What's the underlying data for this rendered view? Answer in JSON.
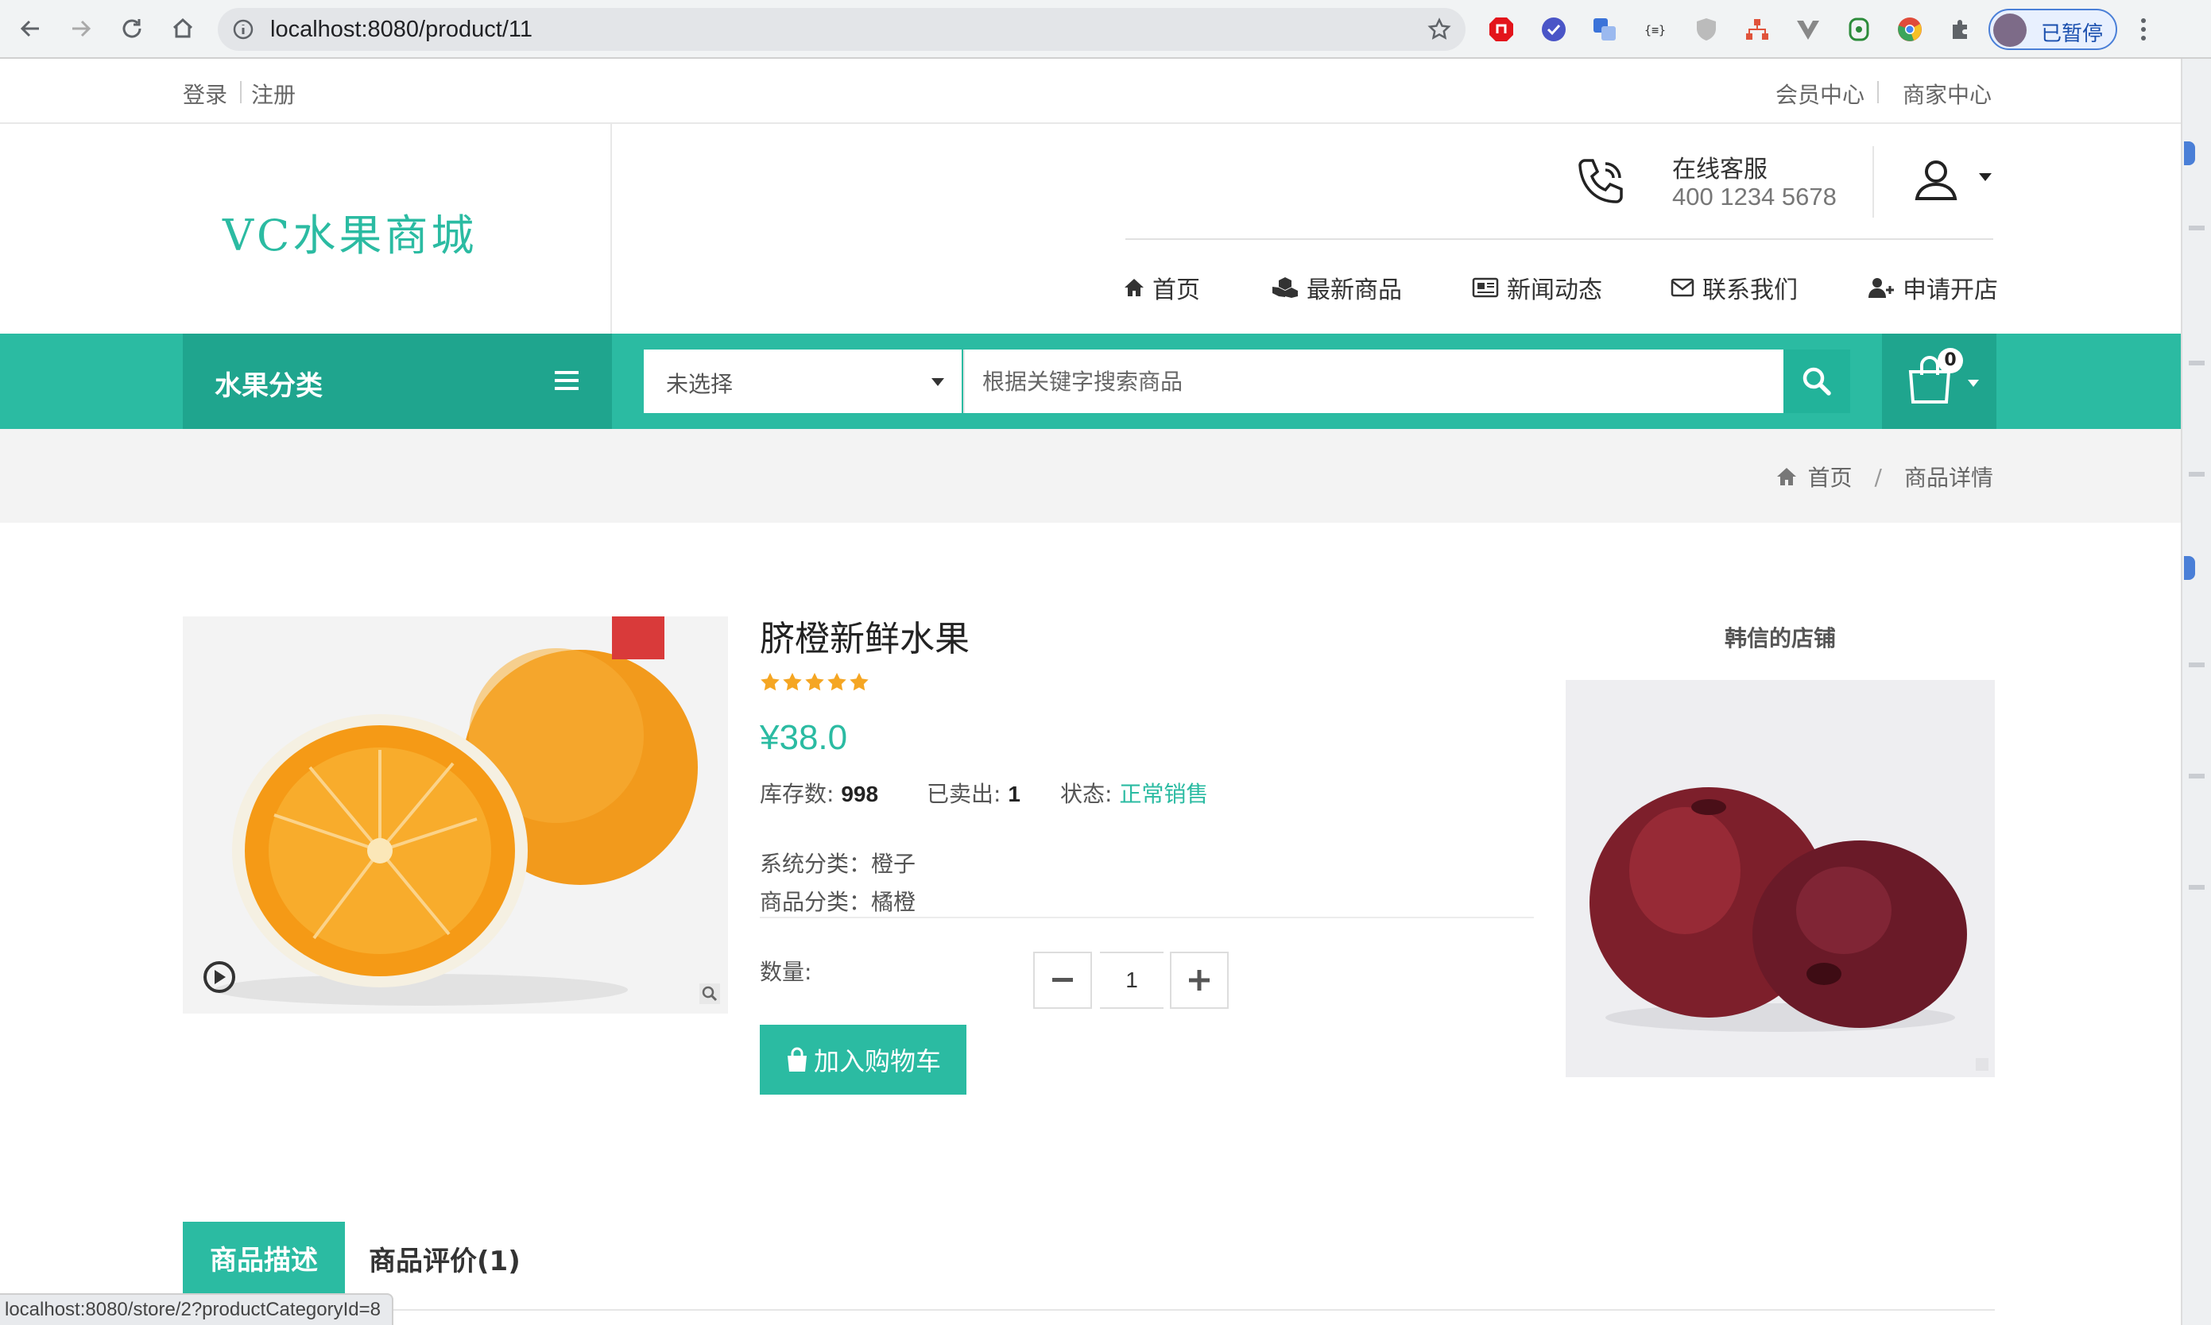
{
  "browser": {
    "url": "localhost:8080/product/11",
    "profile_label": "已暂停",
    "status_url": "localhost:8080/store/2?productCategoryId=8"
  },
  "topbar": {
    "login": "登录",
    "register": "注册",
    "member_center": "会员中心",
    "merchant_center": "商家中心"
  },
  "header": {
    "logo": "VC水果商城",
    "service_title": "在线客服",
    "service_phone": "400 1234 5678",
    "nav": [
      {
        "label": "首页",
        "icon": "home-icon"
      },
      {
        "label": "最新商品",
        "icon": "cubes-icon"
      },
      {
        "label": "新闻动态",
        "icon": "newspaper-icon"
      },
      {
        "label": "联系我们",
        "icon": "envelope-icon"
      },
      {
        "label": "申请开店",
        "icon": "user-plus-icon"
      }
    ]
  },
  "search_bar": {
    "category_label": "水果分类",
    "select_value": "未选择",
    "placeholder": "根据关键字搜索商品",
    "cart_count": "0"
  },
  "breadcrumb": {
    "home": "首页",
    "separator": "/",
    "current": "商品详情"
  },
  "product": {
    "title": "脐橙新鲜水果",
    "rating": 5,
    "price": "¥38.0",
    "stock_label": "库存数:",
    "stock_value": "998",
    "sold_label": "已卖出:",
    "sold_value": "1",
    "status_label": "状态:",
    "status_value": "正常销售",
    "system_category": "系统分类：橙子",
    "product_category": "商品分类：橘橙",
    "quantity_label": "数量:",
    "quantity": "1",
    "add_to_cart": "加入购物车"
  },
  "shop": {
    "name": "韩信的店铺"
  },
  "tabs": [
    {
      "label": "商品描述",
      "active": true
    },
    {
      "label": "商品评价(1)",
      "active": false
    }
  ],
  "colors": {
    "accent": "#2bbba2",
    "accent_dark": "#1fa58e"
  }
}
